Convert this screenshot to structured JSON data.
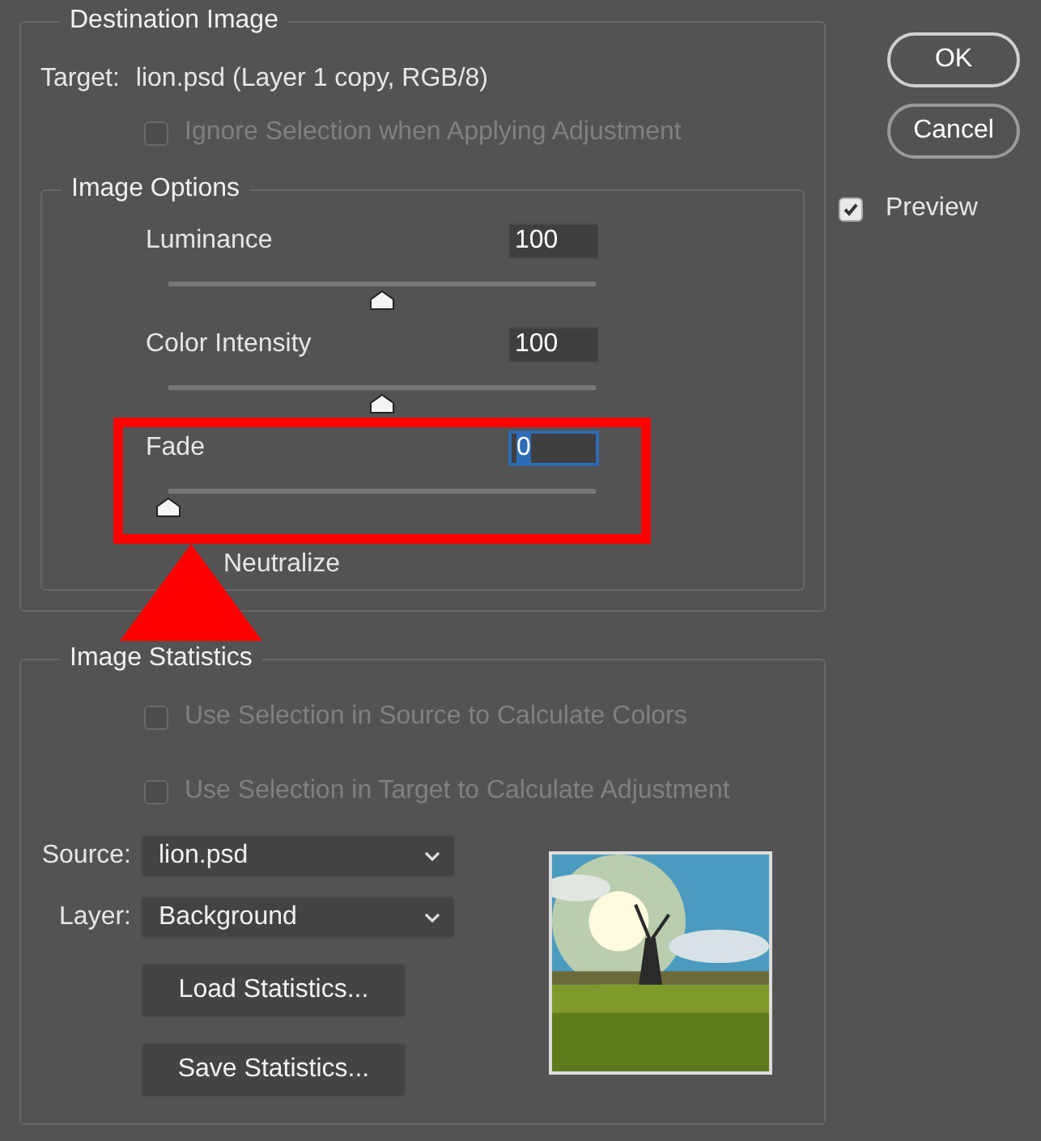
{
  "destination": {
    "title": "Destination Image",
    "target_label": "Target:",
    "target_value": "lion.psd (Layer 1 copy, RGB/8)",
    "ignore_selection": {
      "label": "Ignore Selection when Applying Adjustment",
      "checked": false,
      "disabled": true
    },
    "image_options": {
      "title": "Image Options",
      "sliders": [
        {
          "label": "Luminance",
          "value": "100",
          "level": 0.5,
          "focused": false
        },
        {
          "label": "Color Intensity",
          "value": "100",
          "level": 0.5,
          "focused": false
        },
        {
          "label": "Fade",
          "value": "0",
          "level": 0,
          "focused": true
        }
      ],
      "neutralize": "Neutralize"
    }
  },
  "statistics": {
    "title": "Image Statistics",
    "checkboxes": [
      {
        "label": "Use Selection in Source to Calculate Colors",
        "checked": false,
        "disabled": true
      },
      {
        "label": "Use Selection in Target to Calculate Adjustment",
        "checked": false,
        "disabled": true
      }
    ],
    "source": {
      "label": "Source:",
      "value": "lion.psd"
    },
    "layer": {
      "label": "Layer:",
      "value": "Background"
    },
    "buttons": [
      "Load Statistics...",
      "Save Statistics..."
    ],
    "preview": {
      "kind": "picture"
    }
  },
  "buttons": [
    "OK",
    "Cancel"
  ],
  "preview": {
    "label": "Preview",
    "checked": true
  }
}
